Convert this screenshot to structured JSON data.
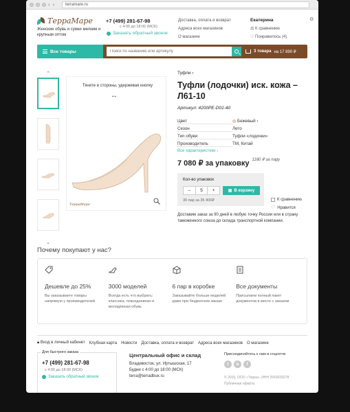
{
  "browser": {
    "url": "terramare.ru"
  },
  "header": {
    "logo_text": "ТерраМаре",
    "tagline": "Женские обувь и сумки мелким и крупным оптом",
    "phone": "+7 (499) 281-67-98",
    "hours": "с 4:00 до 18:00 (МСК)",
    "callback": "Заказать обратный звонок",
    "links": [
      "Доставка, оплата и возврат",
      "Адреса всех магазинов",
      "О магазине"
    ],
    "user_name": "Екатерина",
    "compare": "К сравнению",
    "liked": "Понравилось (4)"
  },
  "searchbar": {
    "all_goods": "Все товары",
    "placeholder": "Поиск по названию или артикулу",
    "cart_count": "3 товара",
    "cart_sum": "на 17 890 ₽"
  },
  "product": {
    "drag_hint": "Тяните в стороны, удерживая кнопку",
    "drag_arrow": "↔",
    "breadcrumb": "Туфли ›",
    "title": "Туфли (лодочки) иск. кожа – Л61-10",
    "article": "Артикул: 4200PE-D01-40",
    "specs": [
      {
        "k": "Цвет",
        "v": "Бежевый ›"
      },
      {
        "k": "Сезон",
        "v": "Лето"
      },
      {
        "k": "Тип обуви",
        "v": "Туфли «лодочки»"
      },
      {
        "k": "Производитель",
        "v": "ТМ, Китай"
      }
    ],
    "all_specs": "Все характеристики ↓",
    "price": "7 080 ₽ за упаковку",
    "price_per_pair": "1180 ₽ за пару",
    "qty_label": "Кол-во упаковок",
    "qty_value": "5",
    "minus": "–",
    "plus": "+",
    "to_cart": "В корзину",
    "pack_note": "30 пар за 35 400₽",
    "compare": "К сравнению",
    "like": "Нравится",
    "delivery": "Доставим заказ за 90 дней в любую точку России или в страну таможенного союза до склада транспортной компании.",
    "mini_logo": "ТерраМаре"
  },
  "thumbs": {
    "up": "⌃",
    "down": "⌄"
  },
  "why": {
    "title": "Почему покупают у нас?",
    "items": [
      {
        "title": "Дешевле до 25%",
        "text": "Вы заказываете товары напрямую у производителей"
      },
      {
        "title": "3000 моделей",
        "text": "Всегда есть что выбрать: классика, повседневная и молодёжная обувь"
      },
      {
        "title": "6 пар в коробке",
        "text": "Заказывайте больше моделей даже при бюджетном заказе"
      },
      {
        "title": "Все документы",
        "text": "Присылаем полный пакет документов в месте с заказом"
      }
    ]
  },
  "footer": {
    "links": [
      "Вход в личный кабинет",
      "Клубная карта",
      "Новости",
      "Доставка, оплата и возврат",
      "Адреса всех магазинов",
      "О магазине"
    ],
    "quick_label": "Для быстрого заказа",
    "phone": "+7 (499) 281-67-98",
    "hours": "с 4:00 до 18:00 (МСК)",
    "callback": "Заказать обратный звонок",
    "office_title": "Центральный офис и склад",
    "address": "Владивосток, ул. Иртышская, 17",
    "office_hours": "Будни с 4:00 до 18:00 (МСК)",
    "email": "terra@terradbux.ru",
    "social_title": "Присоединяйтесь к нам в соцсетях",
    "copyright": "© 2016, ООО «Терра», ИНН 2543029278",
    "offer": "Публичная оферта"
  },
  "colors": {
    "teal": "#2eb8a6",
    "brown": "#7a4b2a"
  }
}
